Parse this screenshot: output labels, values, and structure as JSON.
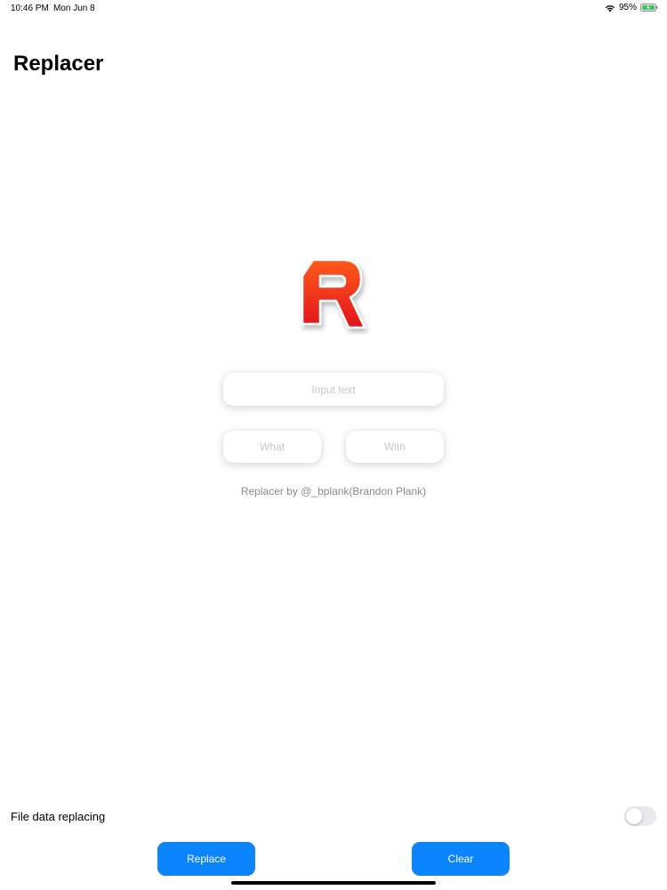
{
  "status_bar": {
    "time": "10:46 PM",
    "date": "Mon Jun 8",
    "battery": "95%",
    "icons": [
      "wifi-icon",
      "battery-charging-icon"
    ]
  },
  "header": {
    "title": "Replacer"
  },
  "logo": {
    "letter": "R",
    "colors": {
      "top": "#ff4a1c",
      "bottom": "#e8141c",
      "border": "#ffffff"
    }
  },
  "form": {
    "input_placeholder": "Input text",
    "input_value": "",
    "what_placeholder": "What",
    "what_value": "",
    "with_placeholder": "With",
    "with_value": ""
  },
  "credit": "Replacer by @_bplank(Brandon Plank)",
  "settings": {
    "file_data_label": "File data replacing",
    "file_data_enabled": false
  },
  "actions": {
    "replace_label": "Replace",
    "clear_label": "Clear",
    "accent": "#0a84ff"
  }
}
